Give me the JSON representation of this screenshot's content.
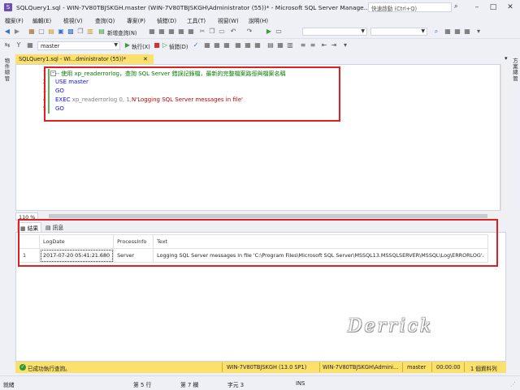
{
  "window": {
    "title": "SQLQuery1.sql - WIN-7V80TBJSKGH.master (WIN-7V80TBJSKGH\\Administrator (55))* - Microsoft SQL Server Manage...",
    "quick_launch_placeholder": "快速啟動 (Ctrl+Q)"
  },
  "menu": [
    "檔案(F)",
    "編輯(E)",
    "檢視(V)",
    "查詢(Q)",
    "專案(P)",
    "偵錯(D)",
    "工具(T)",
    "視窗(W)",
    "說明(H)"
  ],
  "toolbar": {
    "new_query_label": "新增查詢(N)",
    "database_value": "master",
    "execute_label": "執行(X)",
    "debug_label": "偵錯(D)"
  },
  "side_panels": {
    "left_label": "物件總管",
    "right_label": "方案總管"
  },
  "editor": {
    "tab_title": "SQLQuery1.sql - WI...dministrator (55))*",
    "zoom": "110 %",
    "lines": [
      {
        "n": "1",
        "text": "-- 使用 xp_readerrorlog，查詢 SQL Server 錯誤記錄檔，最新的完整檔案路徑與檔案名稱"
      },
      {
        "n": "2",
        "text": "USE master"
      },
      {
        "n": "3",
        "text": "GO"
      },
      {
        "n": "4",
        "kw": "EXEC",
        "mid": " xp_readerrorlog 0, 1,",
        "str": "N'Logging SQL Server messages in file'"
      },
      {
        "n": "5",
        "text": "GO"
      }
    ]
  },
  "results": {
    "tabs": [
      "結果",
      "訊息"
    ],
    "columns": [
      "LogDate",
      "ProcessInfo",
      "Text"
    ],
    "rows": [
      {
        "num": "1",
        "LogDate": "2017-07-20 05:41:21.680",
        "ProcessInfo": "Server",
        "Text": "Logging SQL Server messages in file 'C:\\Program Files\\Microsoft SQL Server\\MSSQL13.MSSQLSERVER\\MSSQL\\Log\\ERRORLOG'."
      }
    ],
    "watermark": "Derrick"
  },
  "results_status": {
    "message": "已成功執行查詢。",
    "server": "WIN-7V80TBJSKGH (13.0 SP1)",
    "user": "WIN-7V80TBJSKGH\\Admini...",
    "database": "master",
    "time": "00:00:00",
    "rows": "1 個資料列"
  },
  "statusbar": {
    "ready": "就緒",
    "line": "第 5 行",
    "col": "第 7 欄",
    "ch": "字元 3",
    "mode": "INS"
  },
  "colors": {
    "accent_yellow": "#fbe16c",
    "annotation_red": "#e02020",
    "keyword_blue": "#0b0bff",
    "comment_green": "#008000"
  }
}
